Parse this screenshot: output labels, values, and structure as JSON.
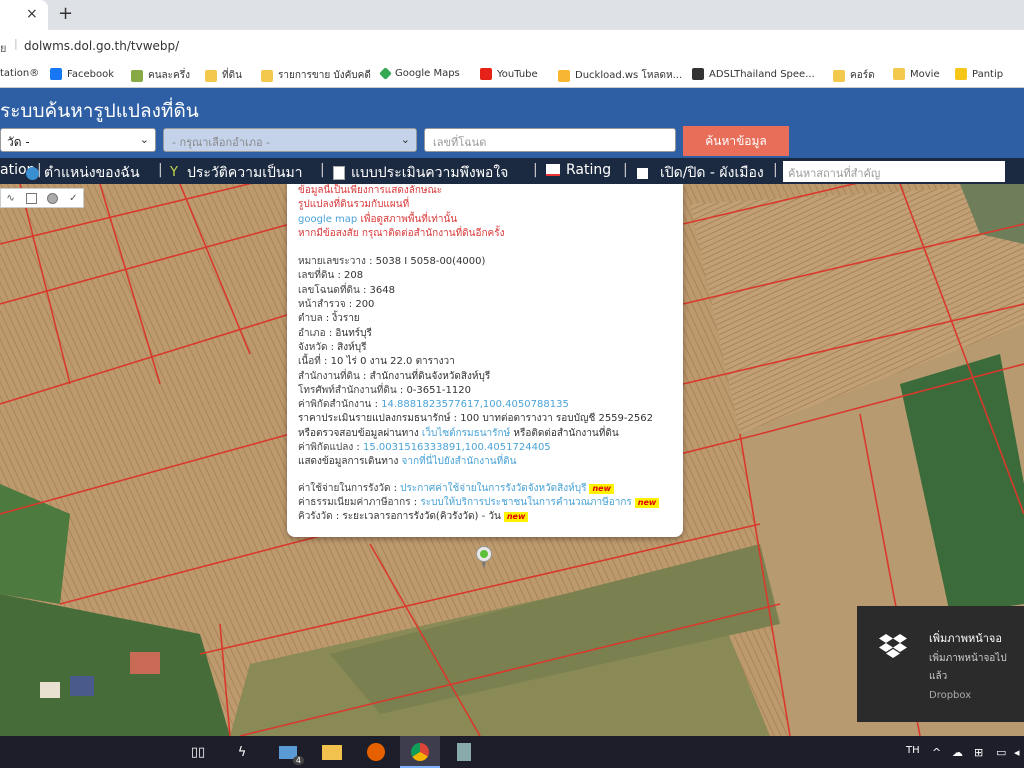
{
  "browser": {
    "tab_close": "×",
    "new_tab": "+",
    "address_prefix": "ย",
    "url": "dolwms.dol.go.th/tvwebp/"
  },
  "bookmarks": [
    {
      "label": "tation®",
      "icon": "globe-icon"
    },
    {
      "label": "Facebook",
      "icon": "facebook-icon"
    },
    {
      "label": "คนละครึ่ง",
      "icon": "kk-icon"
    },
    {
      "label": "ที่ดิน",
      "icon": "folder-icon"
    },
    {
      "label": "รายการขาย บังคับคดี",
      "icon": "folder-icon"
    },
    {
      "label": "Google Maps",
      "icon": "maps-icon"
    },
    {
      "label": "YouTube",
      "icon": "youtube-icon"
    },
    {
      "label": "Duckload.ws โหลดห...",
      "icon": "duck-icon"
    },
    {
      "label": "ADSLThailand Spee...",
      "icon": "github-icon"
    },
    {
      "label": "คอร์ด",
      "icon": "folder-icon"
    },
    {
      "label": "Movie",
      "icon": "folder-icon"
    },
    {
      "label": "Pantip",
      "icon": "pantip-icon"
    }
  ],
  "site": {
    "title": "ระบบค้นหารูปแปลงที่ดิน",
    "province_select": "วัด -",
    "district_select": "- กรุณาเลือกอำเภอ -",
    "parcel_placeholder": "เลขที่โฉนด",
    "search_button": "ค้นหาข้อมูล"
  },
  "nav": {
    "item1": "ation",
    "my_location": "ตำแหน่งของฉัน",
    "history": "ประวัติความเป็นมา",
    "survey": "แบบประเมินความพึงพอใจ",
    "rating": "Rating",
    "toggle_city_plan": "เปิด/ปิด - ผังเมือง",
    "separator": "|",
    "place_search_placeholder": "ค้นหาสถานที่สำคัญ"
  },
  "popup": {
    "notice_lines": [
      "ข้อมูลนี้เป็นเพียงการแสดงลักษณะ",
      "รูปแปลงที่ดินรวมกับแผนที่"
    ],
    "gmap_link": "google map",
    "gmap_suffix": " เพื่อดูสภาพพื้นที่เท่านั้น",
    "contact_line": "หากมีข้อสงสัย กรุณาติดต่อสำนักงานที่ดินอีกครั้ง",
    "fields": [
      {
        "label": "หมายเลขระวาง",
        "value": " : 5038 I 5058-00(4000)"
      },
      {
        "label": "เลขที่ดิน",
        "value": " : 208"
      },
      {
        "label": "เลขโฉนดที่ดิน",
        "value": " : 3648"
      },
      {
        "label": "หน้าสำรวจ",
        "value": " : 200"
      },
      {
        "label": "ตำบล",
        "value": " : งิ้วราย"
      },
      {
        "label": "อำเภอ",
        "value": " : อินทร์บุรี"
      },
      {
        "label": "จังหวัด",
        "value": " : สิงห์บุรี"
      },
      {
        "label": "เนื้อที่",
        "value": " : 10 ไร่ 0 งาน 22.0 ตารางวา"
      },
      {
        "label": "สำนักงานที่ดิน",
        "value": " : สำนักงานที่ดินจังหวัดสิงห์บุรี"
      },
      {
        "label": "โทรศัพท์สำนักงานที่ดิน",
        "value": " : 0-3651-1120"
      }
    ],
    "office_coord_label": "ค่าพิกัดสำนักงาน",
    "office_coord_sep": " : ",
    "office_coord_value": "14.8881823577617,100.4050788135",
    "appraisal_line": "ราคาประเมินรายแปลงกรมธนารักษ์ : 100 บาทต่อตารางวา รอบบัญชี 2559-2562",
    "check_prefix": "หรือตรวจสอบข้อมูลผ่านทาง ",
    "check_link": "เว็บไซต์กรมธนารักษ์",
    "check_suffix": " หรือติดต่อสำนักงานที่ดิน",
    "parcel_coord_label": "ค่าพิกัดแปลง",
    "parcel_coord_sep": " : ",
    "parcel_coord_value": "15.0031516333891,100.4051724405",
    "route_prefix": "แสดงข้อมูลการเดินทาง ",
    "route_link": "จากที่นี่ไปยังสำนักงานที่ดิน",
    "fee_label": "ค่าใช้จ่ายในการรังวัด",
    "fee_sep": " : ",
    "fee_link": "ประกาศค่าใช้จ่ายในการรังวัดจังหวัดสิงห์บุรี",
    "tax_label": "ค่าธรรมเนียมค่าภาษีอากร",
    "tax_sep": " : ",
    "tax_link": "ระบบให้บริการประชาชนในการคำนวณภาษีอากร",
    "queue_label": "คิวรังวัด",
    "queue_sep": " : ",
    "queue_value": "ระยะเวลารอการรังวัด(คิวรังวัด) - วัน",
    "new_badge": "new"
  },
  "toast": {
    "title": "เพิ่มภาพหน้าจอ",
    "body_line1": "เพิ่มภาพหน้าจอไป",
    "body_line2": "แล้ว",
    "source": "Dropbox"
  },
  "taskbar": {
    "mail_badge": "4",
    "lang": "TH"
  },
  "colors": {
    "header_blue": "#2e5fa5",
    "nav_dark": "#1b2a40",
    "search_button": "#e86e5a",
    "parcel_lines": "#d9392c",
    "notice_red": "#d93a3a",
    "link_blue": "#4aa3d6"
  }
}
